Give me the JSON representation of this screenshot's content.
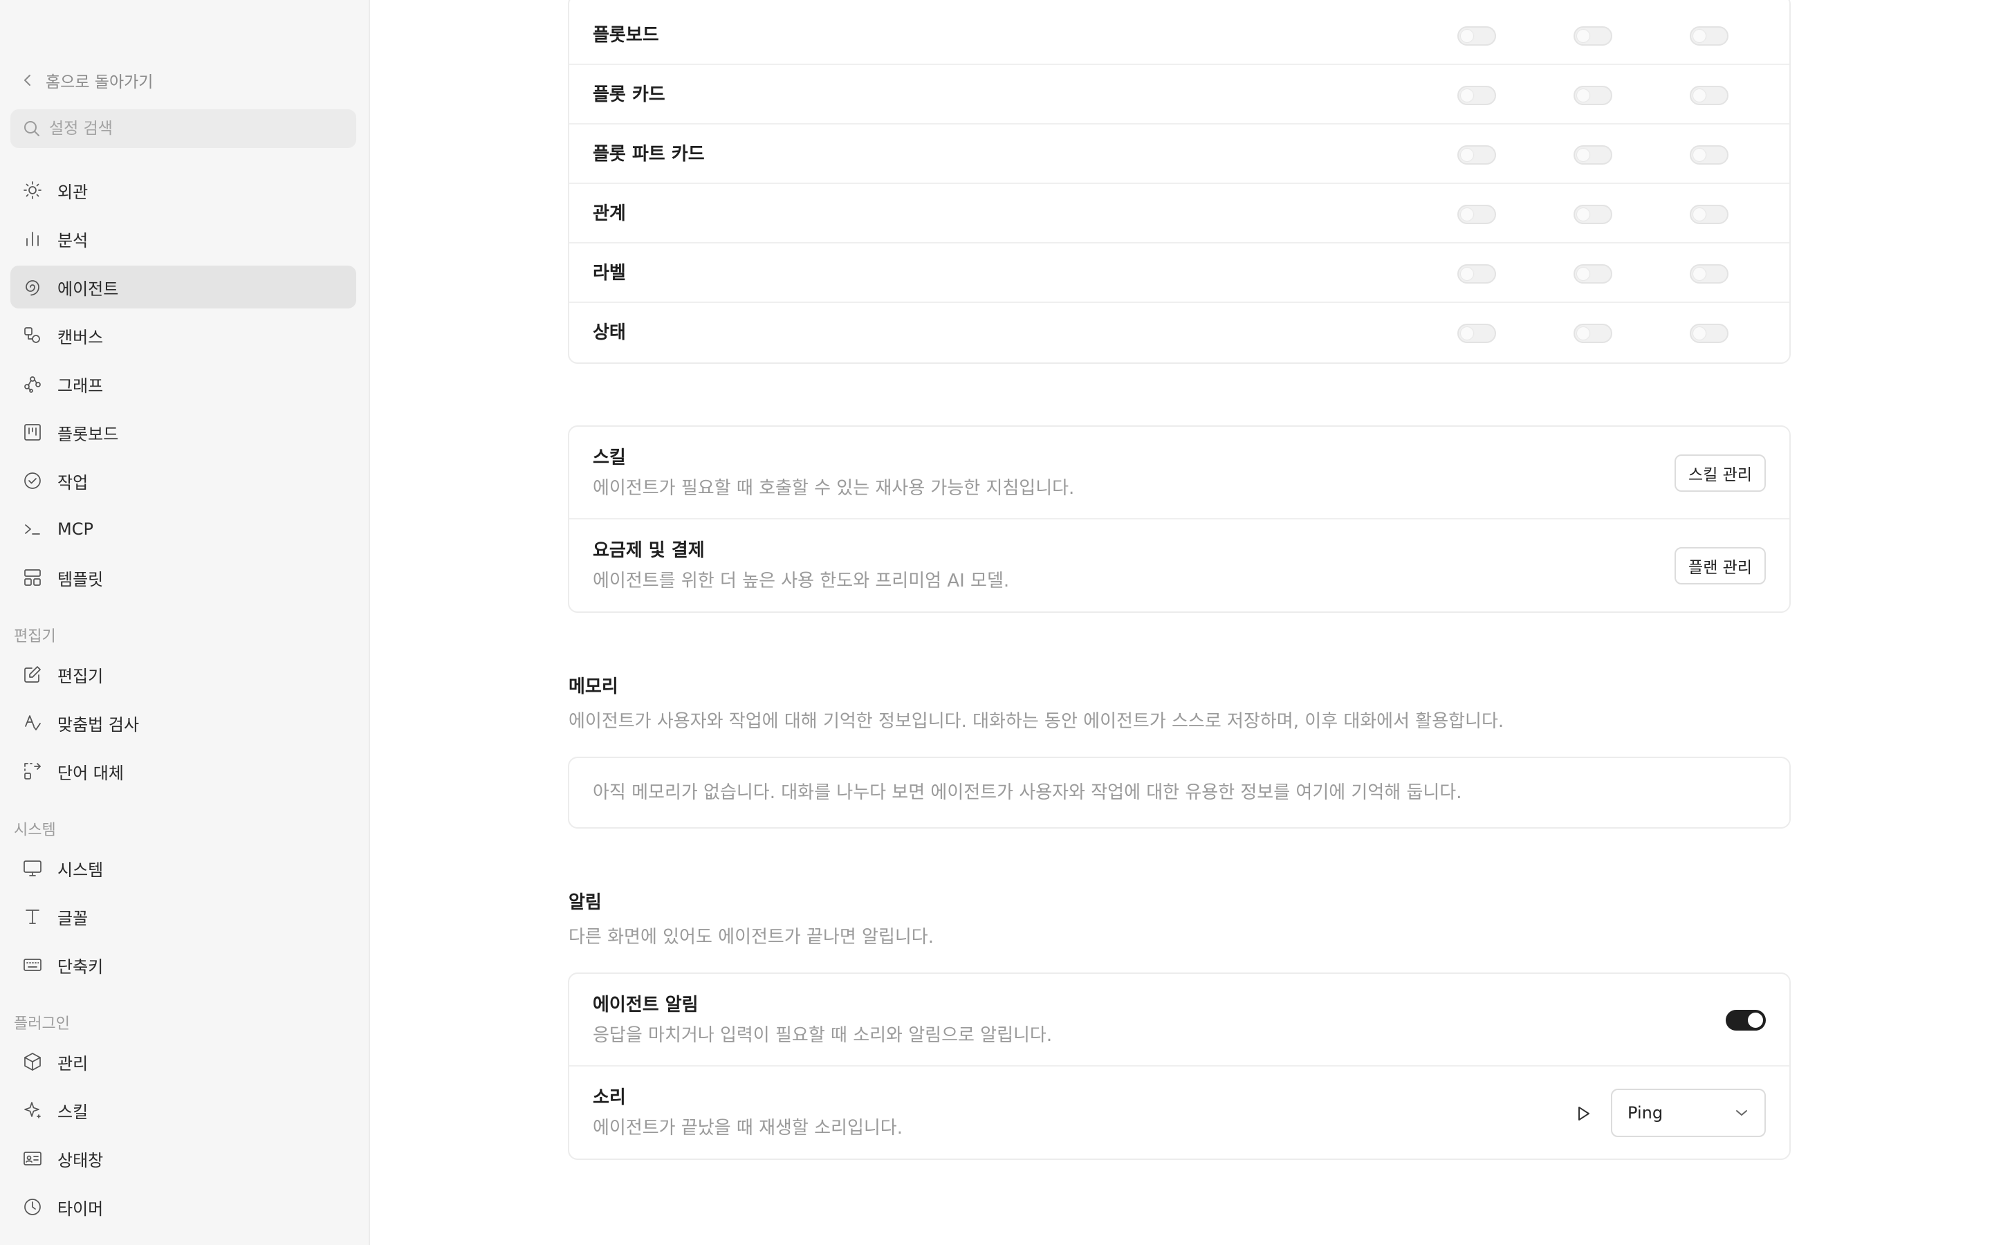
{
  "sidebar": {
    "back_label": "홈으로 돌아가기",
    "search_placeholder": "설정 검색",
    "items_main": [
      {
        "label": "외관",
        "icon": "sun-icon"
      },
      {
        "label": "분석",
        "icon": "bar-chart-icon"
      },
      {
        "label": "에이전트",
        "icon": "spiral-icon",
        "active": true
      },
      {
        "label": "캔버스",
        "icon": "shapes-icon"
      },
      {
        "label": "그래프",
        "icon": "graph-icon"
      },
      {
        "label": "플롯보드",
        "icon": "kanban-icon"
      },
      {
        "label": "작업",
        "icon": "check-circle-icon"
      },
      {
        "label": "MCP",
        "icon": "terminal-icon"
      },
      {
        "label": "템플릿",
        "icon": "layout-icon"
      }
    ],
    "section_editor": "편집기",
    "items_editor": [
      {
        "label": "편집기",
        "icon": "edit-icon"
      },
      {
        "label": "맞춤법 검사",
        "icon": "spellcheck-icon"
      },
      {
        "label": "단어 대체",
        "icon": "replace-icon"
      }
    ],
    "section_system": "시스템",
    "items_system": [
      {
        "label": "시스템",
        "icon": "monitor-icon"
      },
      {
        "label": "글꼴",
        "icon": "type-icon"
      },
      {
        "label": "단축키",
        "icon": "keyboard-icon"
      }
    ],
    "section_plugins": "플러그인",
    "items_plugins": [
      {
        "label": "관리",
        "icon": "package-icon"
      },
      {
        "label": "스킬",
        "icon": "sparkle-icon"
      },
      {
        "label": "상태창",
        "icon": "id-card-icon"
      },
      {
        "label": "타이머",
        "icon": "clock-icon"
      }
    ]
  },
  "permissions": {
    "rows": [
      "플롯보드",
      "플롯 카드",
      "플롯 파트 카드",
      "관계",
      "라벨",
      "상태"
    ]
  },
  "skills_card": {
    "skills_title": "스킬",
    "skills_desc": "에이전트가 필요할 때 호출할 수 있는 재사용 가능한 지침입니다.",
    "skills_button": "스킬 관리",
    "plan_title": "요금제 및 결제",
    "plan_desc": "에이전트를 위한 더 높은 사용 한도와 프리미엄 AI 모델.",
    "plan_button": "플랜 관리"
  },
  "memory": {
    "title": "메모리",
    "desc": "에이전트가 사용자와 작업에 대해 기억한 정보입니다. 대화하는 동안 에이전트가 스스로 저장하며, 이후 대화에서 활용합니다.",
    "empty": "아직 메모리가 없습니다. 대화를 나누다 보면 에이전트가 사용자와 작업에 대한 유용한 정보를 여기에 기억해 둡니다."
  },
  "notifications": {
    "title": "알림",
    "desc": "다른 화면에 있어도 에이전트가 끝나면 알립니다.",
    "agent_title": "에이전트 알림",
    "agent_desc": "응답을 마치거나 입력이 필요할 때 소리와 알림으로 알립니다.",
    "agent_enabled": true,
    "sound_title": "소리",
    "sound_desc": "에이전트가 끝났을 때 재생할 소리입니다.",
    "sound_value": "Ping"
  }
}
